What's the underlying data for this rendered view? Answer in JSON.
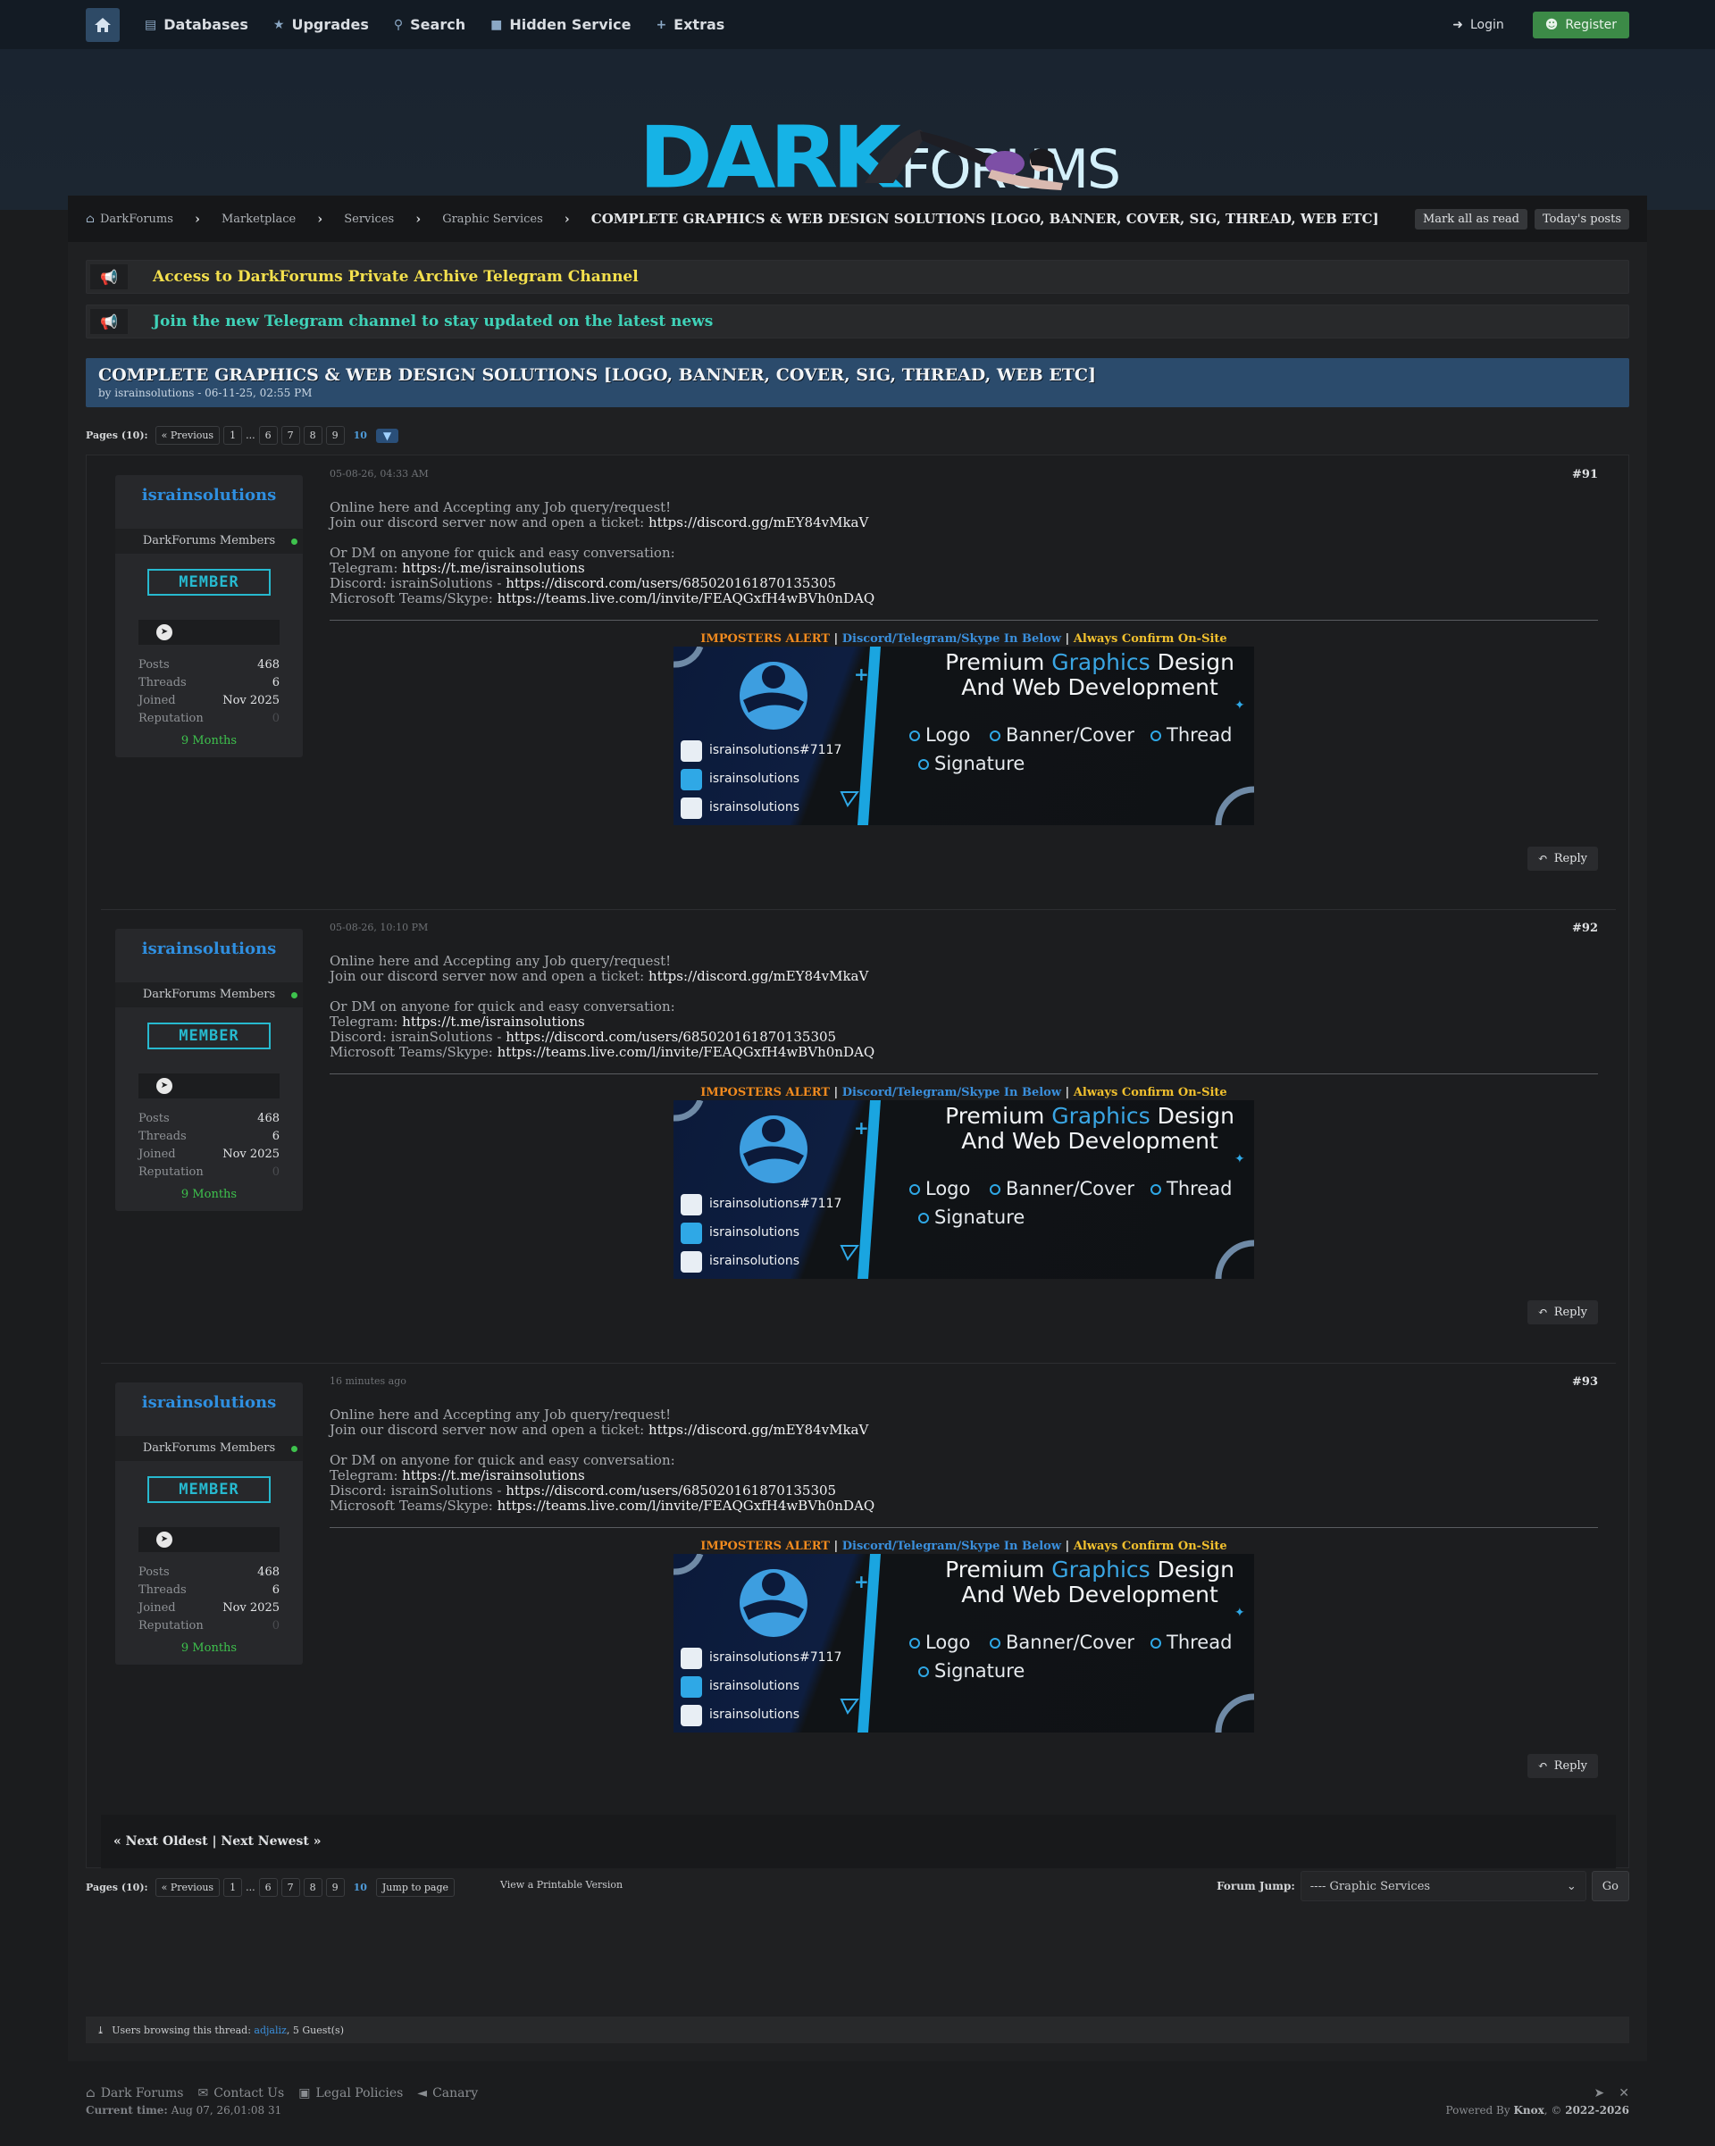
{
  "nav": {
    "items": [
      {
        "icon": "database-icon",
        "label": "Databases"
      },
      {
        "icon": "star-icon",
        "label": "Upgrades"
      },
      {
        "icon": "search-icon",
        "label": "Search"
      },
      {
        "icon": "building-icon",
        "label": "Hidden Service"
      },
      {
        "icon": "plus-icon",
        "label": "Extras"
      }
    ],
    "login": "Login",
    "register": "Register"
  },
  "logo": {
    "dark": "DARK",
    "forums": "FORUMS"
  },
  "breadcrumb": {
    "items": [
      "DarkForums",
      "Marketplace",
      "Services",
      "Graphic Services"
    ],
    "current": "COMPLETE GRAPHICS & WEB DESIGN SOLUTIONS [LOGO, BANNER, COVER, SIG, THREAD, WEB ETC]",
    "mark_read": "Mark all as read",
    "todays_posts": "Today's posts"
  },
  "announcements": [
    {
      "text": "Access to DarkForums Private Archive Telegram Channel",
      "color": "#f4e04d"
    },
    {
      "text": "Join the new Telegram channel to stay updated on the latest news",
      "color": "#3fd2b8"
    }
  ],
  "thread": {
    "title": "COMPLETE GRAPHICS & WEB DESIGN SOLUTIONS [LOGO, BANNER, COVER, SIG, THREAD, WEB ETC]",
    "byline": "by israinsolutions - 06-11-25, 02:55 PM"
  },
  "pager": {
    "label": "Pages (10):",
    "prev": "« Previous",
    "pages": [
      "1",
      "...",
      "6",
      "7",
      "8",
      "9"
    ],
    "current": "10",
    "jump": "Jump to page"
  },
  "user": {
    "name": "israinsolutions",
    "group": "DarkForums Members",
    "badge": "MEMBER",
    "stats": [
      [
        "Posts",
        "468"
      ],
      [
        "Threads",
        "6"
      ],
      [
        "Joined",
        "Nov 2025"
      ],
      [
        "Reputation",
        "0"
      ]
    ],
    "age": "9 Months"
  },
  "post_text": {
    "l1": "Online here and Accepting any Job query/request!",
    "l2a": "Join our discord server now and open a ticket: ",
    "l2b": "https://discord.gg/mEY84vMkaV",
    "l3": "Or DM on anyone for quick and easy conversation:",
    "l4a": "Telegram: ",
    "l4b": "https://t.me/israinsolutions",
    "l5a": "Discord: israinSolutions - ",
    "l5b": "https://discord.com/users/685020161870135305",
    "l6a": "Microsoft Teams/Skype: ",
    "l6b": "https://teams.live.com/l/invite/FEAQGxfH4wBVh0nDAQ"
  },
  "alert": {
    "a": "IMPOSTERS ALERT",
    "sep": " | ",
    "b": "Discord/Telegram/Skype In Below",
    "c": "Always Confirm On-Site"
  },
  "sig": {
    "headline1a": "Premium ",
    "headline1b": "Graphics",
    "headline1c": " Design",
    "headline2": "And Web Development",
    "services": [
      "Logo",
      "Banner/Cover",
      "Thread",
      "Signature"
    ],
    "contacts": [
      "israinsolutions#7117",
      "israinsolutions",
      "israinsolutions"
    ]
  },
  "posts": [
    {
      "date": "05-08-26, 04:33 AM",
      "num": "#91"
    },
    {
      "date": "05-08-26, 10:10 PM",
      "num": "#92"
    },
    {
      "date": "16 minutes ago",
      "num": "#93"
    }
  ],
  "reply": "Reply",
  "next_nav": "« Next Oldest | Next Newest »",
  "printable": "View a Printable Version",
  "forum_jump": {
    "label": "Forum Jump:",
    "selected": "---- Graphic Services",
    "go": "Go"
  },
  "browsing": {
    "prefix": "Users browsing this thread: ",
    "user": "adjaliz",
    "suffix": ", 5 Guest(s)"
  },
  "footer": {
    "links": [
      "Dark Forums",
      "Contact Us",
      "Legal Policies",
      "Canary"
    ],
    "time_label": "Current time:",
    "time": "Aug 07, 26,01:08 31",
    "powered": "Powered By ",
    "knox": "Knox",
    ", ": ", ",
    "copy": ", © ",
    "years": "2022-2026"
  },
  "colors": {
    "accent": "#2f8fe0",
    "cyan": "#27b9cf",
    "orange": "#f08a1e",
    "blue": "#3a8fdc",
    "yellow": "#f2c12e",
    "green": "#3ec24d"
  }
}
